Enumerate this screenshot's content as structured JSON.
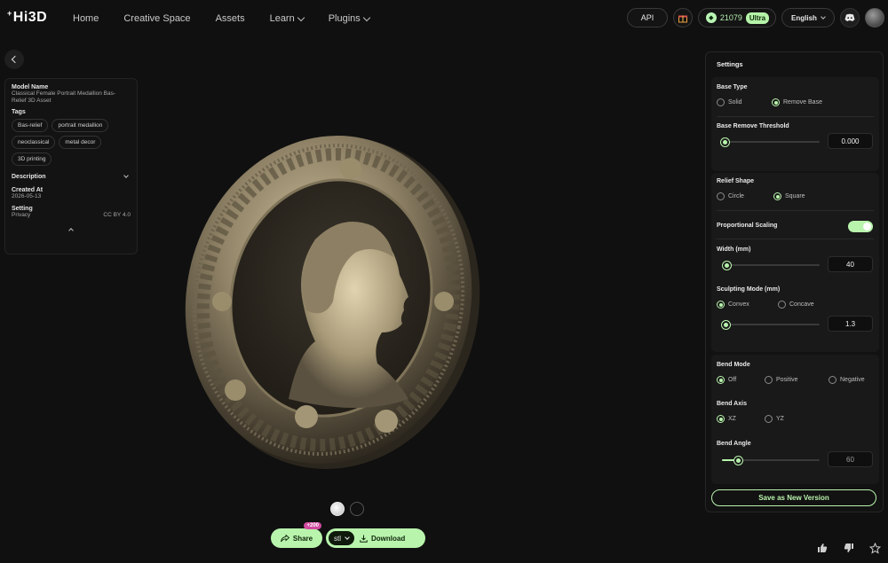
{
  "brand": {
    "logo": "Hi3D"
  },
  "nav": [
    {
      "label": "Home"
    },
    {
      "label": "Creative Space"
    },
    {
      "label": "Assets"
    },
    {
      "label": "Learn",
      "dropdown": true
    },
    {
      "label": "Plugins",
      "dropdown": true
    }
  ],
  "topright": {
    "api": "API",
    "credits": "21079",
    "plan": "Ultra",
    "language": "English",
    "icons": [
      "gift-icon",
      "discord-icon",
      "avatar"
    ]
  },
  "info": {
    "model_name_label": "Model Name",
    "model_name": "Classical Female Portrait Medallion Bas-Relief 3D Asset",
    "tags_label": "Tags",
    "tags": [
      "Bas-relief",
      "portrait medallion",
      "neoclassical",
      "metal decor",
      "3D printing"
    ],
    "description_label": "Description",
    "created_label": "Created At",
    "created": "2026-05-13",
    "setting_label": "Setting",
    "privacy_label": "Privacy",
    "privacy_value": "CC BY 4.0"
  },
  "bottom": {
    "share": "Share",
    "share_badge": "+200",
    "format": "stl",
    "download": "Download"
  },
  "settings": {
    "title": "Settings",
    "base_type_label": "Base Type",
    "base_type_options": [
      "Solid",
      "Remove Base"
    ],
    "base_type_selected": "Remove Base",
    "threshold_label": "Base Remove Threshold",
    "threshold_value": "0.000",
    "relief_shape_label": "Relief Shape",
    "relief_shape_options": [
      "Circle",
      "Square"
    ],
    "relief_shape_selected": "Square",
    "proportional_label": "Proportional Scaling",
    "proportional_on": true,
    "width_label": "Width (mm)",
    "width_value": "40",
    "sculpt_label": "Sculpting Mode (mm)",
    "sculpt_options": [
      "Convex",
      "Concave"
    ],
    "sculpt_selected": "Convex",
    "sculpt_value": "1.3",
    "bend_mode_label": "Bend Mode",
    "bend_mode_options": [
      "Off",
      "Positive",
      "Negative"
    ],
    "bend_mode_selected": "Off",
    "bend_axis_label": "Bend Axis",
    "bend_axis_options": [
      "XZ",
      "YZ"
    ],
    "bend_axis_selected": "XZ",
    "bend_angle_label": "Bend Angle",
    "bend_angle_value": "60",
    "save_label": "Save as New Version"
  },
  "colors": {
    "accent": "#b9f4ad",
    "badge": "#d24aa0",
    "bg": "#101010"
  }
}
